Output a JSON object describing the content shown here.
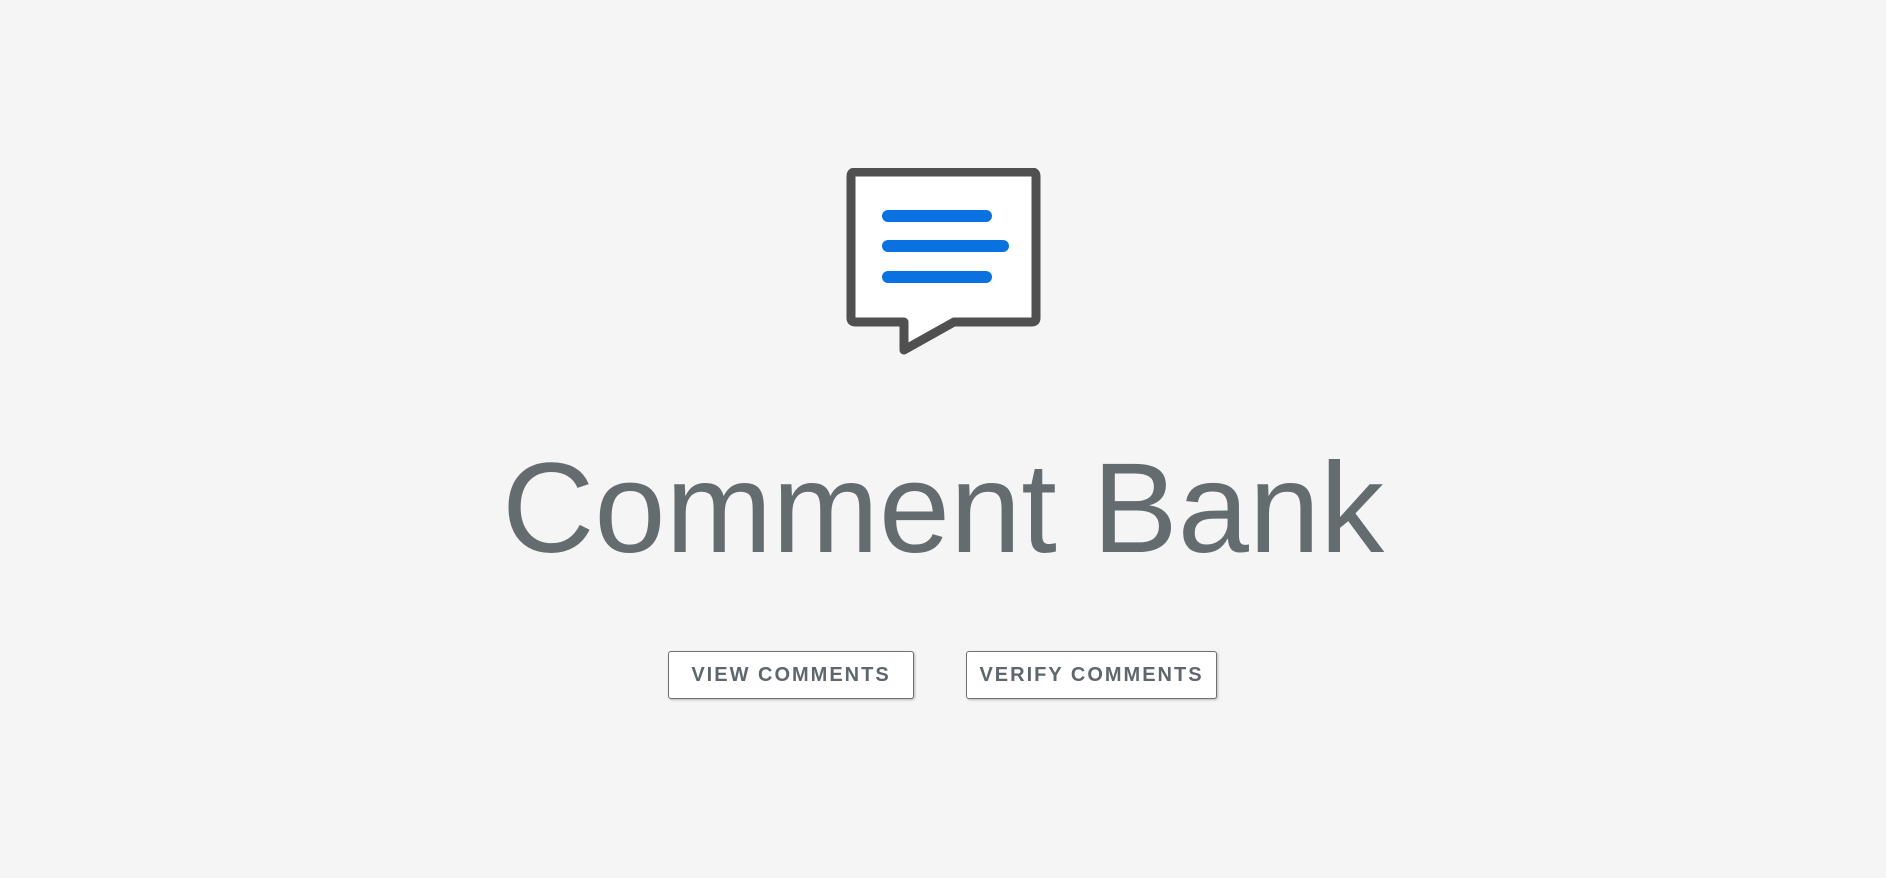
{
  "app": {
    "title": "Comment Bank"
  },
  "logo": {
    "icon": "comment-bank-speech-bubble-icon",
    "frame_color": "#505050",
    "line_color": "#0a72e0"
  },
  "actions": {
    "view_label": "VIEW COMMENTS",
    "verify_label": "VERIFY COMMENTS"
  },
  "colors": {
    "background": "#f5f5f5",
    "title_text": "#646c70",
    "button_text": "#5e676b"
  }
}
